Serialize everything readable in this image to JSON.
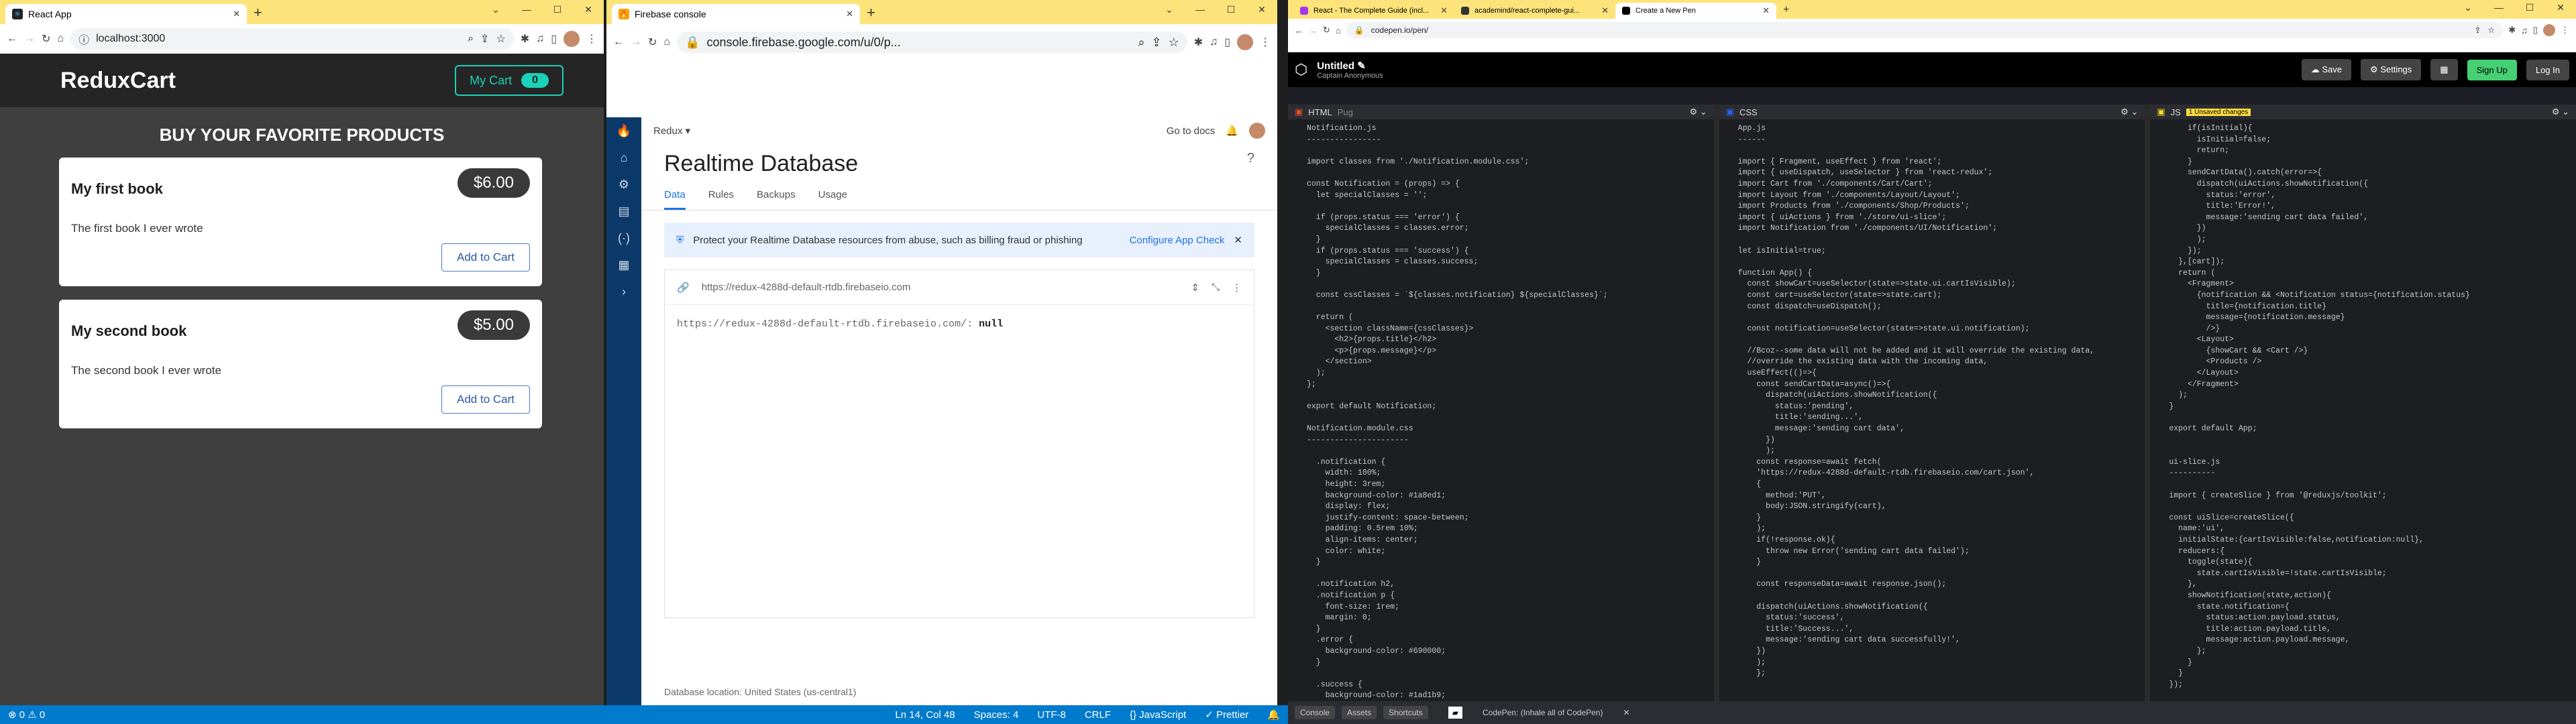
{
  "win1": {
    "tab_title": "React App",
    "url": "localhost:3000",
    "app": {
      "logo": "ReduxCart",
      "cart_label": "My Cart",
      "cart_count": "0",
      "heading": "BUY YOUR FAVORITE PRODUCTS",
      "products": [
        {
          "name": "My first book",
          "price": "$6.00",
          "desc": "The first book I ever wrote",
          "btn": "Add to Cart"
        },
        {
          "name": "My second book",
          "price": "$5.00",
          "desc": "The second book I ever wrote",
          "btn": "Add to Cart"
        }
      ]
    }
  },
  "win2": {
    "tab_title": "Firebase console",
    "url": "console.firebase.google.com/u/0/p...",
    "project": "Redux",
    "go_docs": "Go to docs",
    "title": "Realtime Database",
    "tabs": [
      "Data",
      "Rules",
      "Backups",
      "Usage"
    ],
    "alert_text": "Protect your Realtime Database resources from abuse, such as billing fraud or phishing",
    "alert_link": "Configure App Check",
    "db_url": "https://redux-4288d-default-rtdb.firebaseio.com",
    "db_line": "https://redux-4288d-default-rtdb.firebaseio.com/:",
    "db_value": "null",
    "db_location": "Database location: United States (us-central1)"
  },
  "win3": {
    "tabs": [
      "React - The Complete Guide (incl...",
      "academind/react-complete-gui...",
      "Create a New Pen"
    ],
    "url": "codepen.io/pen/",
    "pen_title": "Untitled",
    "pen_author": "Captain Anonymous",
    "buttons": [
      "Save",
      "Settings",
      "Sign Up",
      "Log In"
    ],
    "panes": [
      {
        "label": "HTML",
        "tag": "Pug",
        "code": [
          "Notification.js",
          "----------------",
          "",
          "import classes from './Notification.module.css';",
          "",
          "const Notification = (props) => {",
          "  let specialClasses = '';",
          "",
          "  if (props.status === 'error') {",
          "    specialClasses = classes.error;",
          "  }",
          "  if (props.status === 'success') {",
          "    specialClasses = classes.success;",
          "  }",
          "",
          "  const cssClasses = `${classes.notification} ${specialClasses}`;",
          "",
          "  return (",
          "    <section className={cssClasses}>",
          "      <h2>{props.title}</h2>",
          "      <p>{props.message}</p>",
          "    </section>",
          "  );",
          "};",
          "",
          "export default Notification;",
          "",
          "Notification.module.css",
          "----------------------",
          "",
          "  .notification {",
          "    width: 100%;",
          "    height: 3rem;",
          "    background-color: #1a8ed1;",
          "    display: flex;",
          "    justify-content: space-between;",
          "    padding: 0.5rem 10%;",
          "    align-items: center;",
          "    color: white;",
          "  }",
          "",
          "  .notification h2,",
          "  .notification p {",
          "    font-size: 1rem;",
          "    margin: 0;",
          "  }",
          "  .error {",
          "    background-color: #690000;",
          "  }",
          "",
          "  .success {",
          "    background-color: #1ad1b9;",
          "  }"
        ]
      },
      {
        "label": "CSS",
        "tag": "",
        "code": [
          "App.js",
          "------",
          "",
          "import { Fragment, useEffect } from 'react';",
          "import { useDispatch, useSelector } from 'react-redux';",
          "import Cart from './components/Cart/Cart';",
          "import Layout from './components/Layout/Layout';",
          "import Products from './components/Shop/Products';",
          "import { uiActions } from './store/ui-slice';",
          "import Notification from './components/UI/Notification';",
          "",
          "let isInitial=true;",
          "",
          "function App() {",
          "  const showCart=useSelector(state=>state.ui.cartIsVisible);",
          "  const cart=useSelector(state=>state.cart);",
          "  const dispatch=useDispatch();",
          "",
          "  const notification=useSelector(state=>state.ui.notification);",
          "",
          "  //Bcoz--some data will not be added and it will override the existing data,",
          "  //override the existing data with the incoming data,",
          "  useEffect(()=>{",
          "    const sendCartData=async()=>{",
          "      dispatch(uiActions.showNotification({",
          "        status:'pending',",
          "        title:'sending...',",
          "        message:'sending cart data',",
          "      })",
          "      );",
          "    const response=await fetch(",
          "    'https://redux-4288d-default-rtdb.firebaseio.com/cart.json',",
          "    {",
          "      method:'PUT',",
          "      body:JSON.stringify(cart),",
          "    }",
          "    );",
          "    if(!response.ok){",
          "      throw new Error('sending cart data failed');",
          "    }",
          "",
          "    const responseData=await response.json();",
          "",
          "    dispatch(uiActions.showNotification({",
          "      status:'success',",
          "      title:'Success...',",
          "      message:'sending cart data successfully!',",
          "    })",
          "    );",
          "    };"
        ]
      },
      {
        "label": "JS",
        "tag": "1 Unsaved changes",
        "code": [
          "    if(isInitial){",
          "      isInitial=false;",
          "      return;",
          "    }",
          "    sendCartData().catch(error=>{",
          "      dispatch(uiActions.showNotification({",
          "        status:'error',",
          "        title:'Error!',",
          "        message:'sending cart data failed',",
          "      })",
          "      );",
          "    });",
          "  },[cart]);",
          "  return (",
          "    <Fragment>",
          "      {notification && <Notification status={notification.status}",
          "        title={notification.title}",
          "        message={notification.message}",
          "        />}",
          "      <Layout>",
          "        {showCart && <Cart />}",
          "        <Products />",
          "      </Layout>",
          "    </Fragment>",
          "  );",
          "}",
          "",
          "export default App;",
          "",
          "",
          "ui-slice.js",
          "----------",
          "",
          "import { createSlice } from '@reduxjs/toolkit';",
          "",
          "const uiSlice=createSlice({",
          "  name:'ui',",
          "  initialState:{cartIsVisible:false,notification:null},",
          "  reducers:{",
          "    toggle(state){",
          "      state.cartIsVisible=!state.cartIsVisible;",
          "    },",
          "    showNotification(state,action){",
          "      state.notification={",
          "        status:action.payload.status,",
          "        title:action.payload.title,",
          "        message:action.payload.message,",
          "      };",
          "    }",
          "  }",
          "});"
        ]
      }
    ],
    "footer": [
      "Console",
      "Assets",
      "Shortcuts"
    ],
    "footer_msg": "CodePen: (Inhale all of CodePen)"
  },
  "statusbar": {
    "left": "⊗ 0 ⚠ 0",
    "items": [
      "Ln 14, Col 48",
      "Spaces: 4",
      "UTF-8",
      "CRLF",
      "{} JavaScript",
      "✓ Prettier"
    ]
  },
  "colors": {
    "accent": "#1ad1b9",
    "firebase_blue": "#1a73e8",
    "vscode_blue": "#007acc"
  }
}
